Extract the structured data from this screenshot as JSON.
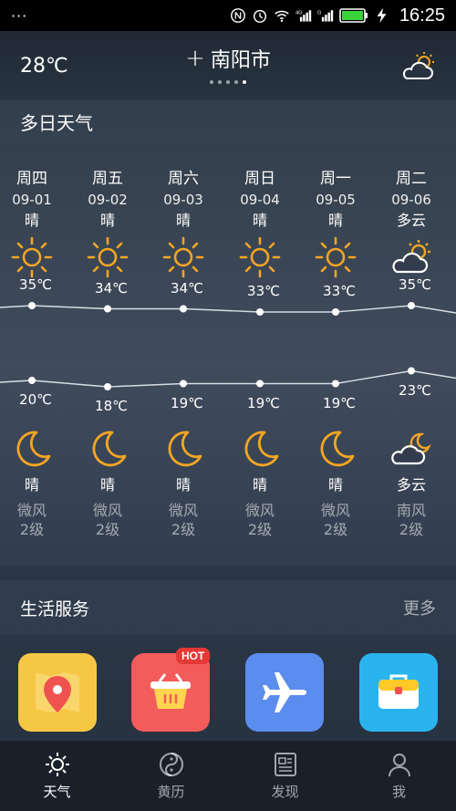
{
  "status_bar": {
    "dots": "···",
    "time": "16:25",
    "icons": [
      "nfc-icon",
      "alarm-icon",
      "wifi-icon",
      "4g-signal-icon",
      "signal-icon",
      "battery-icon",
      "charging-icon"
    ]
  },
  "header": {
    "current_temp": "28℃",
    "city": "南阳市",
    "add_symbol": "+",
    "weather_icon": "partly-cloudy-icon",
    "page_count": 5,
    "active_page": 4
  },
  "forecast": {
    "title": "多日天气",
    "days": [
      {
        "name": "周四",
        "date": "09-01",
        "day_cond": "晴",
        "high": 35,
        "high_label": "35℃",
        "low": 20,
        "low_label": "20℃",
        "night_cond": "晴",
        "wind_dir": "微风",
        "wind_level": "2级",
        "day_icon": "sun-icon",
        "night_icon": "moon-icon"
      },
      {
        "name": "周五",
        "date": "09-02",
        "day_cond": "晴",
        "high": 34,
        "high_label": "34℃",
        "low": 18,
        "low_label": "18℃",
        "night_cond": "晴",
        "wind_dir": "微风",
        "wind_level": "2级",
        "day_icon": "sun-icon",
        "night_icon": "moon-icon"
      },
      {
        "name": "周六",
        "date": "09-03",
        "day_cond": "晴",
        "high": 34,
        "high_label": "34℃",
        "low": 19,
        "low_label": "19℃",
        "night_cond": "晴",
        "wind_dir": "微风",
        "wind_level": "2级",
        "day_icon": "sun-icon",
        "night_icon": "moon-icon"
      },
      {
        "name": "周日",
        "date": "09-04",
        "day_cond": "晴",
        "high": 33,
        "high_label": "33℃",
        "low": 19,
        "low_label": "19℃",
        "night_cond": "晴",
        "wind_dir": "微风",
        "wind_level": "2级",
        "day_icon": "sun-icon",
        "night_icon": "moon-icon"
      },
      {
        "name": "周一",
        "date": "09-05",
        "day_cond": "晴",
        "high": 33,
        "high_label": "33℃",
        "low": 19,
        "low_label": "19℃",
        "night_cond": "晴",
        "wind_dir": "微风",
        "wind_level": "2级",
        "day_icon": "sun-icon",
        "night_icon": "moon-icon"
      },
      {
        "name": "周二",
        "date": "09-06",
        "day_cond": "多云",
        "high": 35,
        "high_label": "35℃",
        "low": 23,
        "low_label": "23℃",
        "night_cond": "多云",
        "wind_dir": "南风",
        "wind_level": "2级",
        "day_icon": "partly-cloudy-icon",
        "night_icon": "cloudy-moon-icon"
      }
    ]
  },
  "services": {
    "title": "生活服务",
    "more": "更多",
    "items": [
      {
        "icon": "map-pin-icon",
        "color": "#f6c744"
      },
      {
        "icon": "shopping-basket-icon",
        "color": "#f45b5b",
        "badge": "HOT"
      },
      {
        "icon": "airplane-icon",
        "color": "#5b8dee"
      },
      {
        "icon": "briefcase-icon",
        "color": "#2ab4ee"
      }
    ]
  },
  "tabs": [
    {
      "label": "天气",
      "icon": "sun-icon",
      "active": true
    },
    {
      "label": "黄历",
      "icon": "yin-yang-icon",
      "active": false
    },
    {
      "label": "发现",
      "icon": "news-icon",
      "active": false
    },
    {
      "label": "我",
      "icon": "person-icon",
      "active": false
    }
  ],
  "colors": {
    "accent_sun": "#f5a623",
    "line": "#d8dde3",
    "hot": "#e53935"
  }
}
